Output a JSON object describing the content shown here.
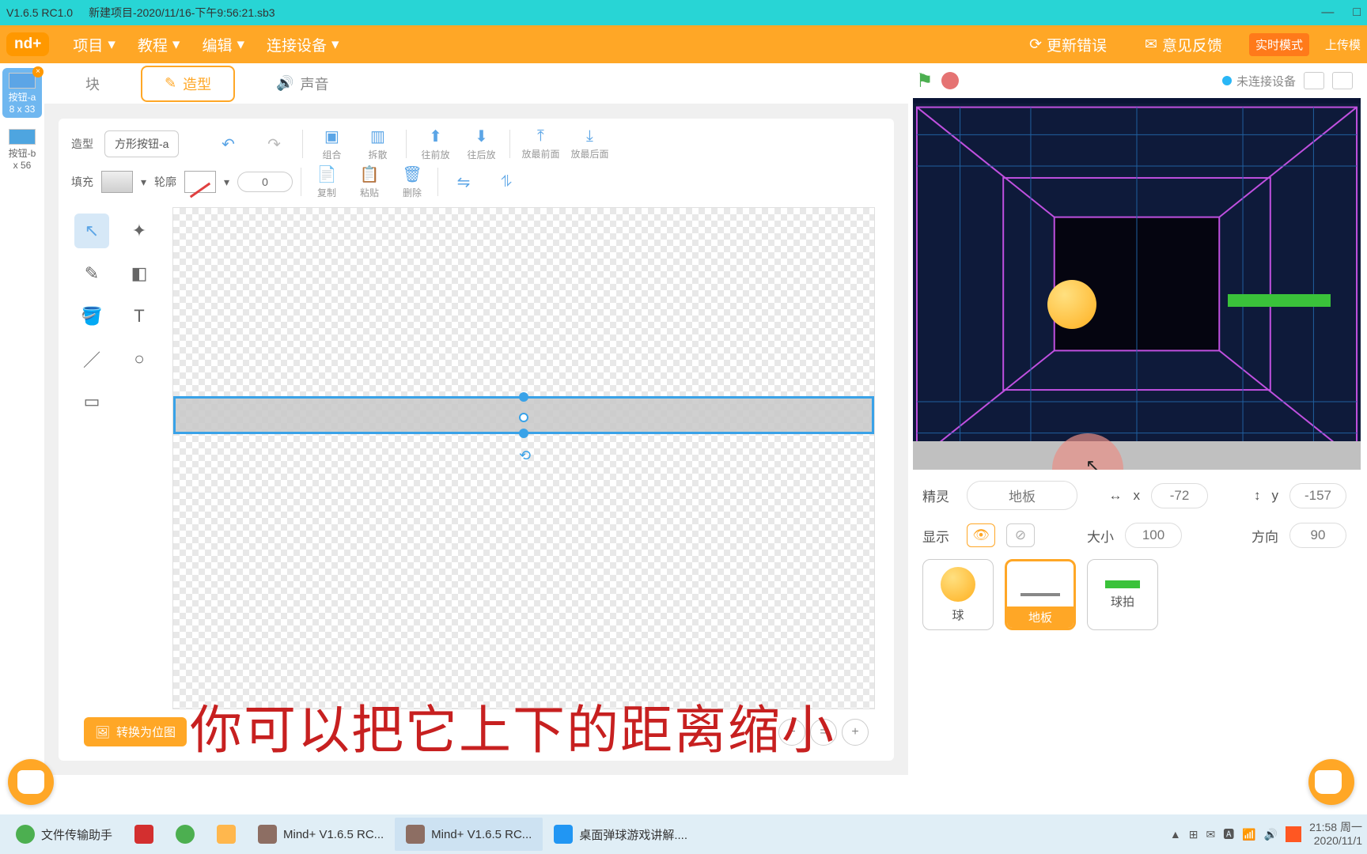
{
  "title": {
    "version": "V1.6.5 RC1.0",
    "project": "新建项目-2020/11/16-下午9:56:21.sb3"
  },
  "window_buttons": {
    "min": "—",
    "max": "□",
    "close": ""
  },
  "menu": {
    "logo": "nd+",
    "items": [
      "项目",
      "教程",
      "编辑",
      "连接设备"
    ],
    "update": "更新错误",
    "feedback": "意见反馈",
    "mode": "实时模式",
    "upload": "上传模"
  },
  "left_tabs": {
    "blocks": "块",
    "costume": "造型",
    "sound": "声音"
  },
  "costumes": [
    {
      "name": "按钮-a",
      "size": "8 x 33",
      "selected": true
    },
    {
      "name": "按钮-b",
      "size": "x 56",
      "selected": false
    }
  ],
  "editor": {
    "costume_label": "造型",
    "costume_name": "方形按钮-a",
    "undo": "↶",
    "redo": "↷",
    "group": "组合",
    "ungroup": "拆散",
    "front": "往前放",
    "back": "往后放",
    "frontmost": "放最前面",
    "backmost": "放最后面",
    "fill": "填充",
    "stroke": "轮廓",
    "stroke_w": "0",
    "copy": "复制",
    "paste": "粘贴",
    "delete": "删除",
    "fliph": "⇋",
    "flipv": "⥮",
    "convert": "转换为位图",
    "zoom_out": "−",
    "zoom_reset": "=",
    "zoom_in": "+"
  },
  "tools": {
    "select": "↖",
    "reshape": "✦",
    "brush": "✎",
    "eraser": "◧",
    "fillb": "🪣",
    "text": "T",
    "line": "／",
    "circle": "○",
    "rect": "▭"
  },
  "stage_header": {
    "not_connected": "未连接设备"
  },
  "props": {
    "sprite": "精灵",
    "name": "地板",
    "x_label": "x",
    "x": "-72",
    "y_label": "y",
    "y": "-157",
    "show": "显示",
    "size_label": "大小",
    "size": "100",
    "dir_label": "方向",
    "dir": "90"
  },
  "sprites": [
    {
      "label": "球"
    },
    {
      "label": "地板"
    },
    {
      "label": "球拍"
    }
  ],
  "subtitle": "你可以把它上下的距离缩小",
  "taskbar": {
    "items": [
      {
        "label": "文件传输助手"
      },
      {
        "label": ""
      },
      {
        "label": ""
      },
      {
        "label": ""
      },
      {
        "label": "Mind+ V1.6.5 RC..."
      },
      {
        "label": "Mind+ V1.6.5 RC..."
      },
      {
        "label": "桌面弹球游戏讲解...."
      }
    ],
    "time": "21:58 周一",
    "date": "2020/11/1"
  }
}
